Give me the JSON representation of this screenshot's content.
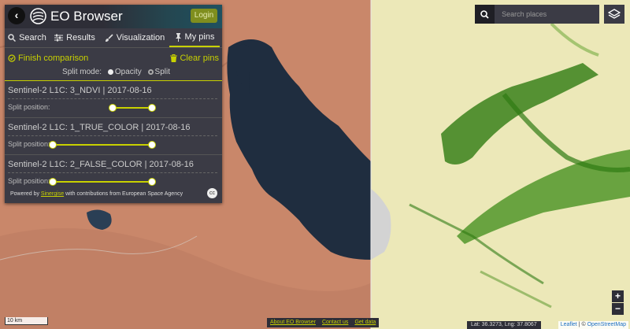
{
  "app": {
    "title": "EO Browser",
    "login_label": "Login",
    "back_icon": "chevron-left-icon",
    "logo_icon": "sentinel-logo-icon"
  },
  "tabs": [
    {
      "label": "Search",
      "icon": "search-icon"
    },
    {
      "label": "Results",
      "icon": "sliders-icon"
    },
    {
      "label": "Visualization",
      "icon": "paintbrush-icon"
    },
    {
      "label": "My pins",
      "icon": "pin-icon",
      "active": true
    }
  ],
  "actions": {
    "finish": "Finish comparison",
    "clear": "Clear pins"
  },
  "split_mode": {
    "label": "Split mode:",
    "opacity": "Opacity",
    "split": "Split",
    "selected": "Split"
  },
  "pins": [
    {
      "title": "Sentinel-2 L1C: 3_NDVI | 2017-08-16",
      "split_label": "Split position:",
      "range_start": 0.6,
      "range_end": 1.0
    },
    {
      "title": "Sentinel-2 L1C: 1_TRUE_COLOR | 2017-08-16",
      "split_label": "Split position:",
      "range_start": 0.0,
      "range_end": 1.0
    },
    {
      "title": "Sentinel-2 L1C: 2_FALSE_COLOR | 2017-08-16",
      "split_label": "Split position:",
      "range_start": 0.0,
      "range_end": 1.0
    }
  ],
  "powered": {
    "prefix": "Powered by",
    "link": "Sinergise",
    "suffix": "with contributions from European Space Agency"
  },
  "search": {
    "placeholder": "Search places"
  },
  "zoom": {
    "in": "+",
    "out": "−"
  },
  "scale": "10 km",
  "footer_links": [
    "About EO Browser",
    "Contact us",
    "Get data"
  ],
  "coords": "Lat: 36.3273, Lng: 37.8067",
  "attribution": {
    "leaflet": "Leaflet",
    "separator": "| ©",
    "osm": "OpenStreetMap"
  },
  "colors": {
    "accent": "#c8d100",
    "panel": "#3b3b45",
    "lake": "#1f2d3f",
    "desert": "#c9876a",
    "ndvi_bg": "#ece8b8",
    "vegetation": "#2f7a12"
  }
}
